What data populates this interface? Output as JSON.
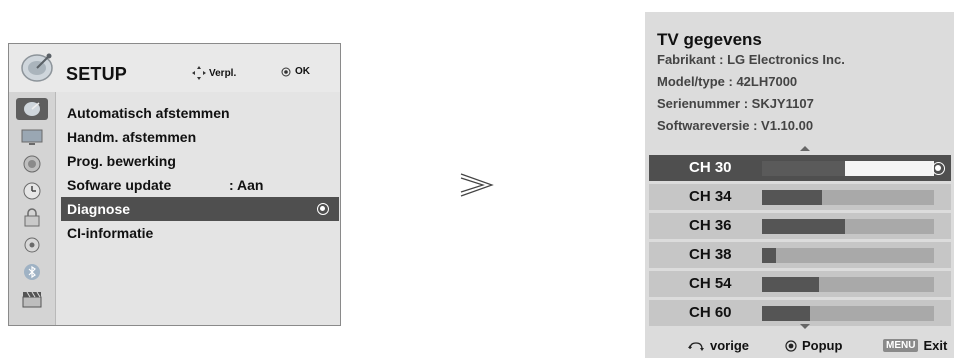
{
  "setup": {
    "title": "SETUP",
    "hint_nav": "Verpl.",
    "hint_ok": "OK",
    "sidebar_icons": [
      "satellite-dish-icon",
      "tv-screen-icon",
      "speaker-icon",
      "clock-icon",
      "lock-icon",
      "input-icon",
      "bluetooth-icon",
      "clapper-icon"
    ],
    "active_sidebar_index": 0,
    "items": [
      {
        "label": "Automatisch afstemmen",
        "value": ""
      },
      {
        "label": "Handm. afstemmen",
        "value": ""
      },
      {
        "label": "Prog. bewerking",
        "value": ""
      },
      {
        "label": "Sofware update",
        "value": ": Aan"
      },
      {
        "label": "Diagnose",
        "value": ""
      },
      {
        "label": "CI-informatie",
        "value": ""
      }
    ],
    "selected_item_index": 4
  },
  "tv_info": {
    "title": "TV gegevens",
    "manufacturer": "Fabrikant : LG Electronics Inc.",
    "model": "Model/type : 42LH7000",
    "serial": "Serienummer : SKJY1107",
    "software": "Softwareversie : V1.10.00",
    "channels": [
      {
        "label": "CH 30",
        "signal": 0.48
      },
      {
        "label": "CH 34",
        "signal": 0.35
      },
      {
        "label": "CH 36",
        "signal": 0.48
      },
      {
        "label": "CH 38",
        "signal": 0.08
      },
      {
        "label": "CH 54",
        "signal": 0.33
      },
      {
        "label": "CH 60",
        "signal": 0.28
      }
    ],
    "selected_channel_index": 0,
    "footer": {
      "back": "vorige",
      "popup": "Popup",
      "menu_key": "MENU",
      "exit": "Exit"
    }
  },
  "colors": {
    "selected_row": "#4f4f4f",
    "panel_bg": "#dcdcdc"
  }
}
